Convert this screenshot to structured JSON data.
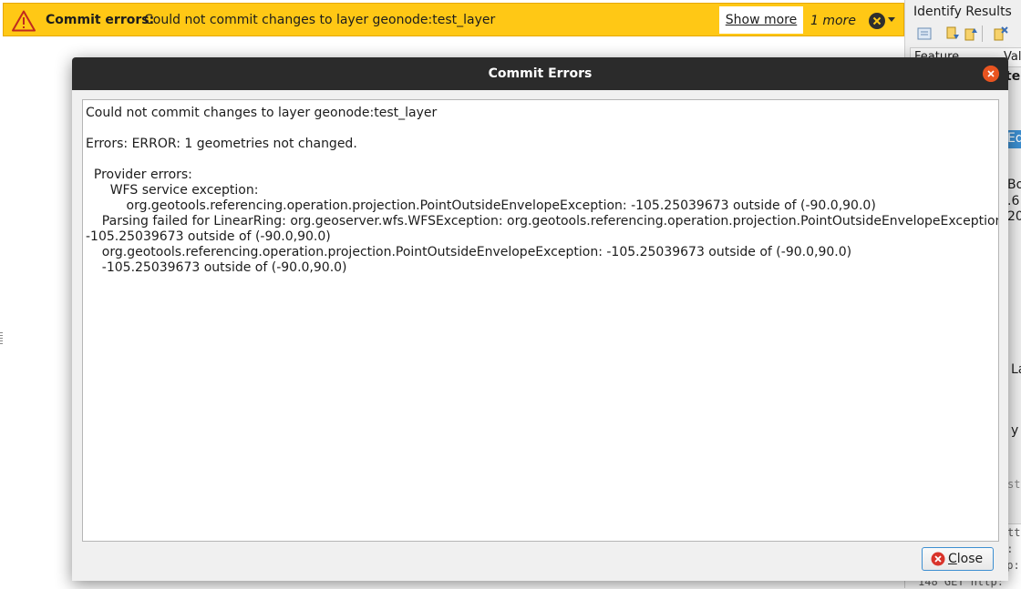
{
  "message_bar": {
    "title": "Commit errors:",
    "text": "Could not commit changes to layer geonode:test_layer",
    "show_more": "Show more",
    "more_count": "1 more",
    "color": "#ffc815"
  },
  "right_dock": {
    "title": "Identify Results",
    "columns": [
      "Feature",
      "Val"
    ],
    "fragments": [
      "test_",
      "Edi",
      "Bo",
      ".6",
      "20",
      "La",
      "y",
      "sts"
    ],
    "log_lines": [
      "ttp",
      "p:",
      "tp:",
      "148 GET http:"
    ]
  },
  "dialog": {
    "title": "Commit Errors",
    "lines": [
      "Could not commit changes to layer geonode:test_layer",
      "",
      "Errors: ERROR: 1 geometries not changed.",
      "",
      "  Provider errors:",
      "      WFS service exception:",
      "          org.geotools.referencing.operation.projection.PointOutsideEnvelopeException: -105.25039673 outside of (-90.0,90.0)",
      "    Parsing failed for LinearRing: org.geoserver.wfs.WFSException: org.geotools.referencing.operation.projection.PointOutsideEnvelopeException:",
      "-105.25039673 outside of (-90.0,90.0)",
      "    org.geotools.referencing.operation.projection.PointOutsideEnvelopeException: -105.25039673 outside of (-90.0,90.0)",
      "    -105.25039673 outside of (-90.0,90.0)"
    ],
    "close_label": "Close",
    "accent": "#e95420"
  },
  "icons": [
    "warning-icon",
    "dismiss-icon",
    "dropdown-arrow-icon",
    "window-close-icon",
    "close-icon"
  ]
}
